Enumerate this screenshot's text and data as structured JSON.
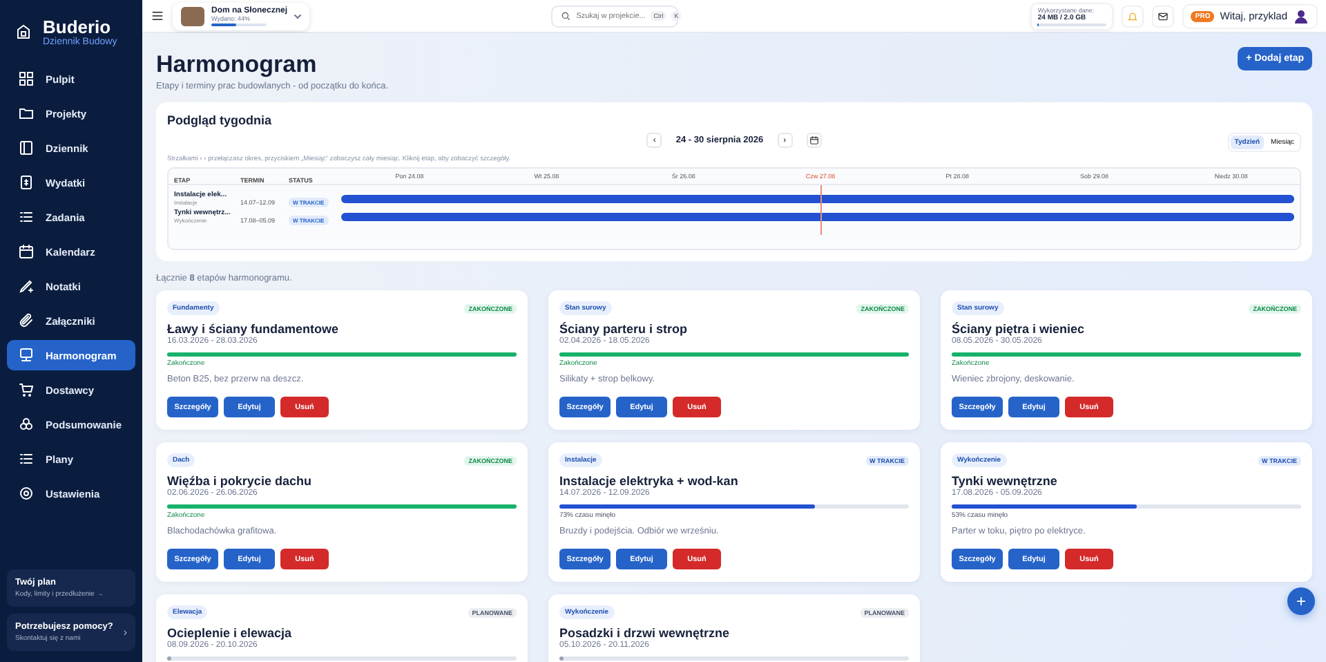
{
  "sidebar": {
    "brand": "Buderio",
    "subtitle": "Dziennik Budowy",
    "items": [
      {
        "label": "Pulpit",
        "selected": false
      },
      {
        "label": "Projekty",
        "selected": false
      },
      {
        "label": "Dziennik",
        "selected": false
      },
      {
        "label": "Wydatki",
        "selected": false
      },
      {
        "label": "Zadania",
        "selected": false
      },
      {
        "label": "Kalendarz",
        "selected": false
      },
      {
        "label": "Notatki",
        "selected": false
      },
      {
        "label": "Załączniki",
        "selected": false
      },
      {
        "label": "Harmonogram",
        "selected": true
      },
      {
        "label": "Dostawcy",
        "selected": false
      },
      {
        "label": "Podsumowanie",
        "selected": false
      },
      {
        "label": "Plany",
        "selected": false
      },
      {
        "label": "Ustawienia",
        "selected": false
      }
    ],
    "plan": {
      "title": "Twój plan",
      "text": "Kody, limity i przedłużenie →"
    },
    "help": {
      "title": "Potrzebujesz pomocy?",
      "text": "Skontaktuj się z nami",
      "arrow": "›"
    }
  },
  "topbar": {
    "project": {
      "name": "Dom na Słonecznej",
      "spent": "Wydano: 44%",
      "level": 0.44
    },
    "search": {
      "placeholder": "Szukaj w projekcie...",
      "keys": [
        "Ctrl",
        "K"
      ]
    },
    "storage": {
      "label": "Wykorzystane dane:",
      "value": "24 MB / 2.0 GB",
      "level": 0.02
    },
    "badge": "PRO",
    "greeting": "Witaj, przyklad"
  },
  "page": {
    "title": "Harmonogram",
    "subtitle": "Etapy i terminy prac budowlanych - od początku do końca.",
    "add_button": "+ Dodaj etap"
  },
  "week": {
    "title": "Podgląd tygodnia",
    "prev": "‹",
    "range": "24 - 30 sierpnia 2026",
    "next": "›",
    "views": [
      {
        "label": "Tydzień",
        "selected": true
      },
      {
        "label": "Miesiąc",
        "selected": false
      }
    ],
    "hint": "Strzałkami ‹ › przełączasz okres, przyciskiem „Miesiąc” zobaczysz cały miesiąc. Kliknij etap, aby zobaczyć szczegóły.",
    "columns": [
      "ETAP",
      "TERMIN",
      "STATUS"
    ],
    "days": [
      {
        "label": "Pon 24.08",
        "today": false
      },
      {
        "label": "Wt 25.08",
        "today": false
      },
      {
        "label": "Śr 26.08",
        "today": false
      },
      {
        "label": "Czw 27.08",
        "today": true
      },
      {
        "label": "Pt 28.08",
        "today": false
      },
      {
        "label": "Sob 29.08",
        "today": false
      },
      {
        "label": "Niedz 30.08",
        "today": false
      }
    ],
    "rows": [
      {
        "name": "Instalacje elek...",
        "category": "Instalacje",
        "term": "14.07–12.09",
        "status": "W TRAKCIE"
      },
      {
        "name": "Tynki wewnętrz...",
        "category": "Wykończenie",
        "term": "17.08–05.09",
        "status": "W TRAKCIE"
      }
    ]
  },
  "summary": "Łącznie **8** etapów harmonogramu.",
  "stages": [
    {
      "category": "Fundamenty",
      "kind": "done",
      "badge": "ZAKOŃCZONE",
      "title": "Ławy i ściany fundamentowe",
      "dates": "16.03.2026 - 28.03.2026",
      "level": 1,
      "progress_text": "Zakończone",
      "note": "Beton B25, bez przerw na deszcz.",
      "actions": [
        "Szczegóły",
        "Edytuj",
        "Usuń"
      ]
    },
    {
      "category": "Stan surowy",
      "kind": "done",
      "badge": "ZAKOŃCZONE",
      "title": "Ściany parteru i strop",
      "dates": "02.04.2026 - 18.05.2026",
      "level": 1,
      "progress_text": "Zakończone",
      "note": "Silikaty + strop belkowy.",
      "actions": [
        "Szczegóły",
        "Edytuj",
        "Usuń"
      ]
    },
    {
      "category": "Stan surowy",
      "kind": "done",
      "badge": "ZAKOŃCZONE",
      "title": "Ściany piętra i wieniec",
      "dates": "08.05.2026 - 30.05.2026",
      "level": 1,
      "progress_text": "Zakończone",
      "note": "Wieniec zbrojony, deskowanie.",
      "actions": [
        "Szczegóły",
        "Edytuj",
        "Usuń"
      ]
    },
    {
      "category": "Dach",
      "kind": "done",
      "badge": "ZAKOŃCZONE",
      "title": "Więźba i pokrycie dachu",
      "dates": "02.06.2026 - 26.06.2026",
      "level": 1,
      "progress_text": "Zakończone",
      "note": "Blachodachówka grafitowa.",
      "actions": [
        "Szczegóły",
        "Edytuj",
        "Usuń"
      ]
    },
    {
      "category": "Instalacje",
      "kind": "active",
      "badge": "W TRAKCIE",
      "title": "Instalacje elektryka + wod-kan",
      "dates": "14.07.2026 - 12.09.2026",
      "level": 0.73,
      "progress_text": "73% czasu minęło",
      "note": "Bruzdy i podejścia. Odbiór we wrześniu.",
      "actions": [
        "Szczegóły",
        "Edytuj",
        "Usuń"
      ]
    },
    {
      "category": "Wykończenie",
      "kind": "active",
      "badge": "W TRAKCIE",
      "title": "Tynki wewnętrzne",
      "dates": "17.08.2026 - 05.09.2026",
      "level": 0.53,
      "progress_text": "53% czasu minęło",
      "note": "Parter w toku, piętro po elektryce.",
      "actions": [
        "Szczegóły",
        "Edytuj",
        "Usuń"
      ]
    },
    {
      "category": "Elewacja",
      "kind": "planned",
      "badge": "PLANOWANE",
      "title": "Ocieplenie i elewacja",
      "dates": "08.09.2026 - 20.10.2026",
      "level": 0.01
    },
    {
      "category": "Wykończenie",
      "kind": "planned",
      "badge": "PLANOWANE",
      "title": "Posadzki i drzwi wewnętrzne",
      "dates": "05.10.2026 - 20.11.2026",
      "level": 0.01
    }
  ],
  "fab": "+"
}
